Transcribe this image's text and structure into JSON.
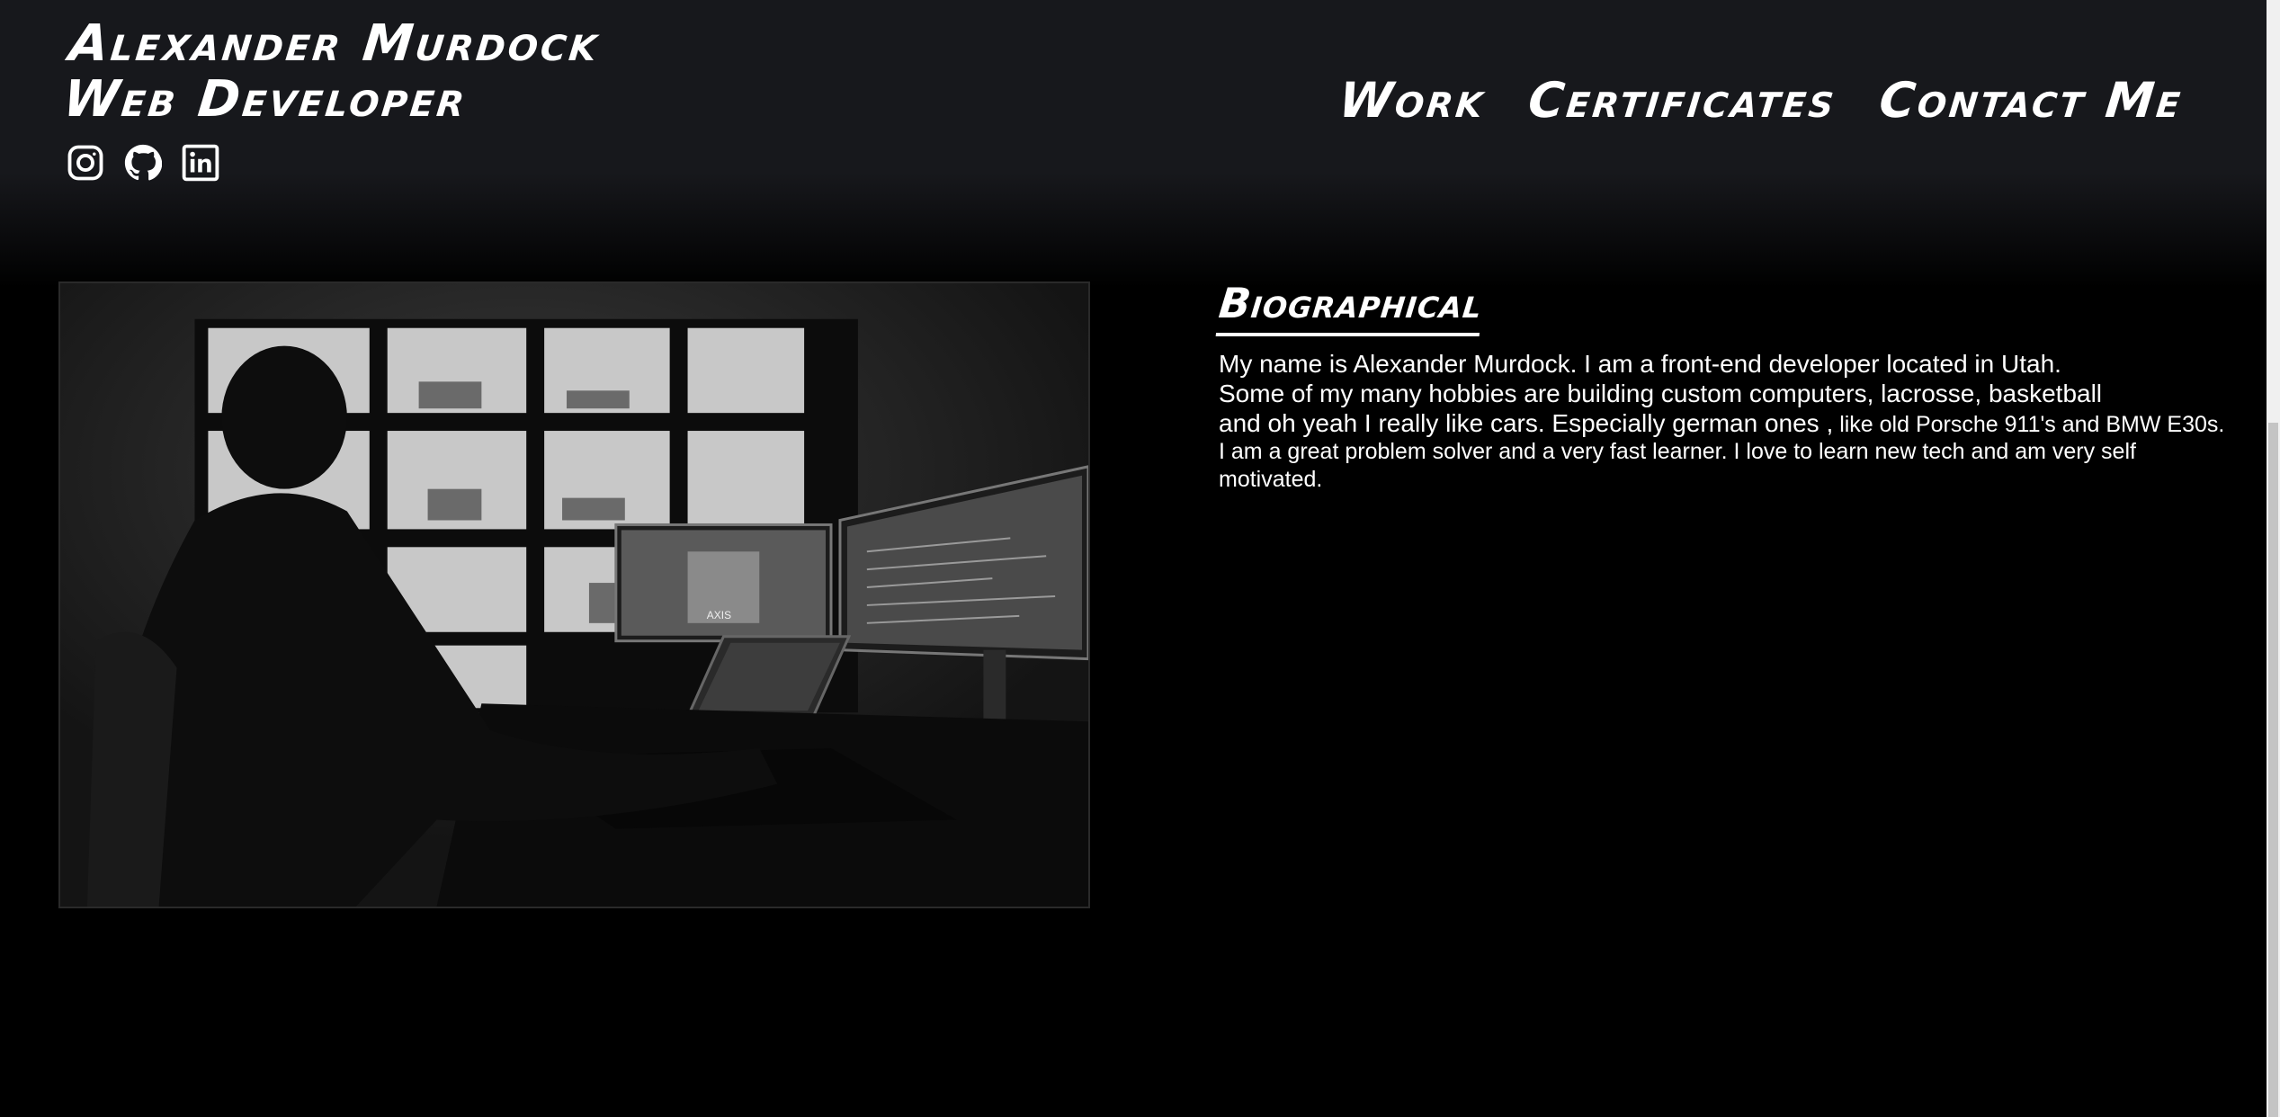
{
  "brand": {
    "name": "Alexander Murdock",
    "role": "Web Developer"
  },
  "social": {
    "icons": [
      "instagram-icon",
      "github-icon",
      "linkedin-icon"
    ]
  },
  "nav": {
    "work": "Work",
    "certificates": "Certificates",
    "contact": "Contact Me"
  },
  "bio": {
    "title": "Biographical",
    "line1": "My name is Alexander Murdock. I am a front-end developer located in Utah.",
    "line2": "Some of my many hobbies are building custom computers, lacrosse, basketball",
    "line3a": "and oh yeah I really like cars. Especially german ones ,",
    "line3b": " like old Porsche 911's and BMW E30s.",
    "line4": "I am a great problem solver and a very fast learner. I love to learn new tech and am very self",
    "line5": "motivated."
  },
  "photo": {
    "monitor_caption": "AXIS"
  },
  "colors": {
    "page_background": "#000000",
    "header_background": "#17181c",
    "text": "#ffffff"
  }
}
